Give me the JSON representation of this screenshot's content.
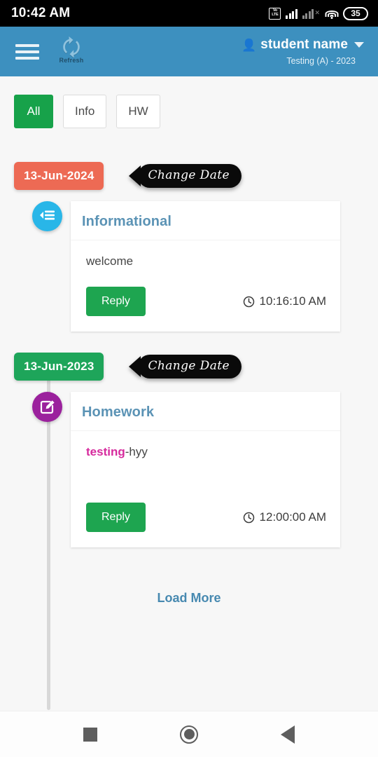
{
  "status_bar": {
    "time": "10:42 AM",
    "volte_line1": "Vo",
    "volte_line2": "LTE",
    "battery": "35",
    "icons": [
      "volte-icon",
      "signal-bars-icon",
      "signal-bars-secondary-icon",
      "wifi-icon",
      "battery-icon"
    ]
  },
  "header": {
    "menu_icon": "hamburger-menu-icon",
    "refresh_label": "Refresh",
    "user_name": "student name",
    "user_subtitle": "Testing (A) - 2023",
    "background_color": "#3d90bf"
  },
  "filters": {
    "tabs": [
      {
        "label": "All",
        "active": true
      },
      {
        "label": "Info",
        "active": false
      },
      {
        "label": "HW",
        "active": false
      }
    ]
  },
  "timeline": {
    "groups": [
      {
        "date": "13-Jun-2024",
        "date_color": "#ed6a54",
        "change_date_label": "Change Date",
        "icon": "announcement-list-icon",
        "icon_color": "#29b6e8",
        "card": {
          "title": "Informational",
          "message_highlight": "",
          "message": "welcome",
          "reply_label": "Reply",
          "time": "10:16:10 AM"
        }
      },
      {
        "date": "13-Jun-2023",
        "date_color": "#1ea55a",
        "change_date_label": "Change Date",
        "icon": "edit-pencil-icon",
        "icon_color": "#9b219d",
        "card": {
          "title": "Homework",
          "message_highlight": "testing",
          "message": "-hyy",
          "reply_label": "Reply",
          "time": "12:00:00 AM"
        }
      }
    ]
  },
  "load_more": {
    "label": "Load More",
    "color": "#4789b0"
  },
  "nav_bar": {
    "recents": "recents-square-icon",
    "home": "home-circle-icon",
    "back": "back-triangle-icon"
  }
}
